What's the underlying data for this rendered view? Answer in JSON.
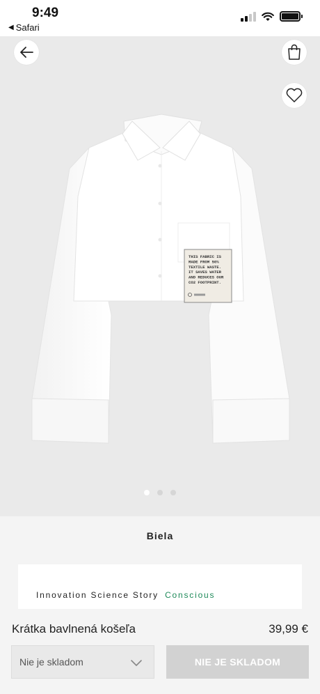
{
  "status_bar": {
    "time": "9:49",
    "back_app": "Safari",
    "back_glyph": "◀"
  },
  "product_image": {
    "label_text": [
      "THIS FABRIC IS",
      "MADE FROM 50%",
      "TEXTILE WASTE.",
      "IT SAVES WATER",
      "AND REDUCES OUR",
      "CO2 FOOTPRINT."
    ],
    "brand_tag": "H&M",
    "carousel": {
      "count": 3,
      "active": 0
    }
  },
  "icons": {
    "back": "arrow-left-icon",
    "bag": "shopping-bag-icon",
    "favorite": "heart-icon",
    "chevron": "chevron-down-icon"
  },
  "product": {
    "color_name": "Biela",
    "story": "Innovation Science Story",
    "story_tag": "Conscious",
    "name": "Krátka bavlnená košeľa",
    "price": "39,99 €"
  },
  "controls": {
    "size_select_value": "Nie je skladom",
    "add_button_label": "NIE JE SKLADOM"
  },
  "colors": {
    "conscious_green": "#1f8a5a",
    "disabled_button": "#d2d2d2",
    "image_background": "#eaeaea"
  }
}
